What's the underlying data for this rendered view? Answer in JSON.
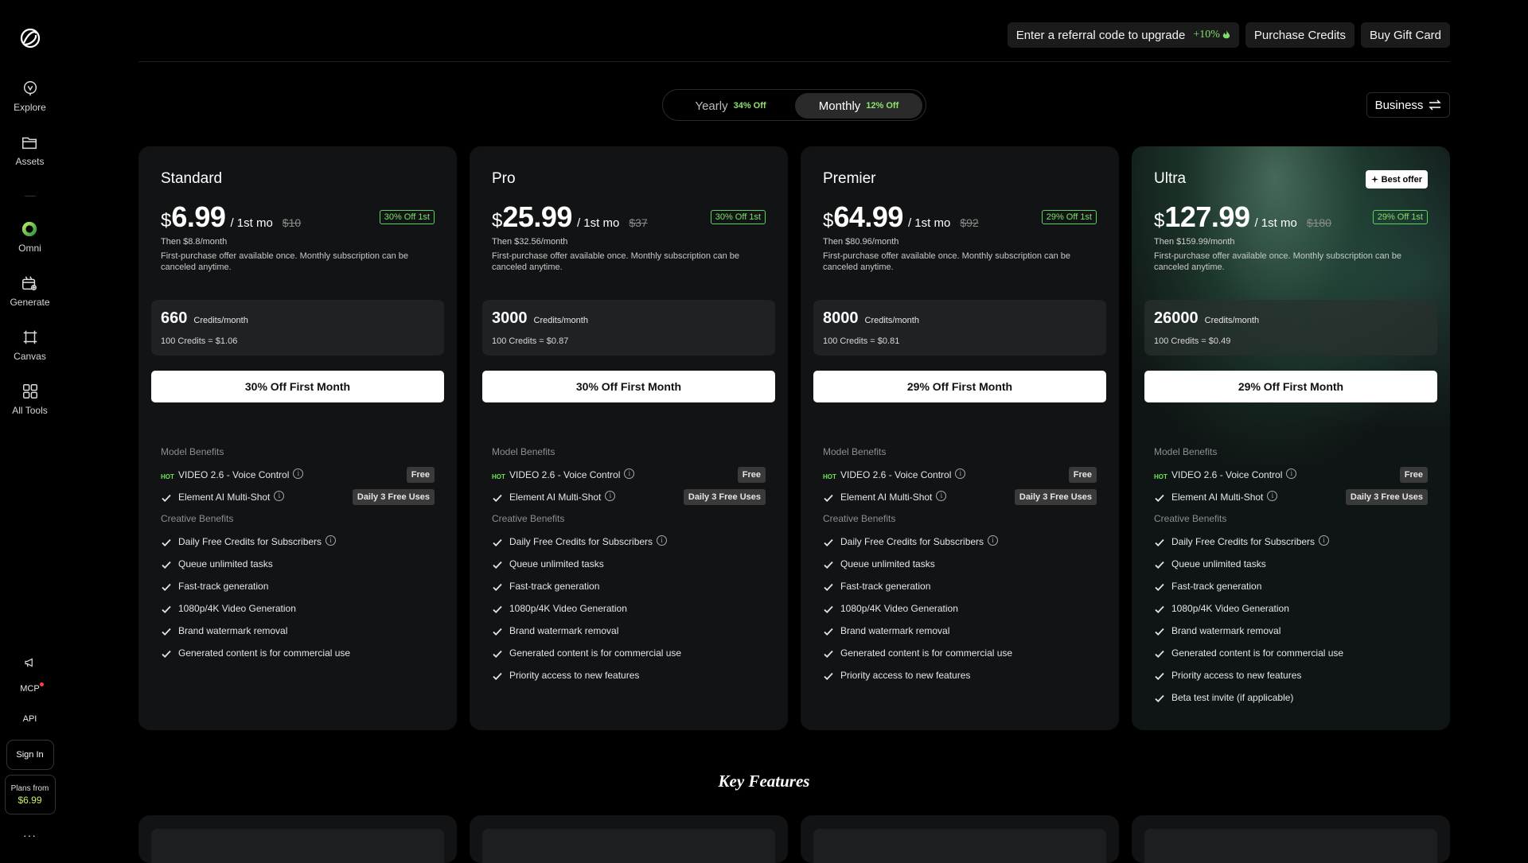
{
  "sidebar": {
    "items": [
      {
        "label": "Explore",
        "icon": "explore-icon"
      },
      {
        "label": "Assets",
        "icon": "folder-icon"
      },
      {
        "label": "Omni",
        "icon": "omni-icon"
      },
      {
        "label": "Generate",
        "icon": "generate-icon"
      },
      {
        "label": "Canvas",
        "icon": "canvas-icon"
      },
      {
        "label": "All Tools",
        "icon": "grid-icon"
      }
    ],
    "mcp_label": "MCP",
    "api_label": "API",
    "sign_in_label": "Sign In",
    "plans_from_label": "Plans from",
    "plans_from_price": "$6.99",
    "more_label": "···"
  },
  "topbar": {
    "referral_label": "Enter a referral code to upgrade",
    "referral_bonus": "+10%",
    "purchase_credits_label": "Purchase Credits",
    "gift_card_label": "Buy Gift Card"
  },
  "billing_toggle": {
    "yearly_label": "Yearly",
    "yearly_off": "34% Off",
    "monthly_label": "Monthly",
    "monthly_off": "12% Off",
    "selected": "Monthly"
  },
  "business_label": "Business",
  "colors": {
    "accent_green": "#7ee06a",
    "card_bg": "#121314",
    "page_bg": "#000000"
  },
  "plans": [
    {
      "name": "Standard",
      "currency": "$",
      "price": "6.99",
      "period": "/ 1st mo",
      "original": "$10",
      "discount_badge": "30% Off 1st",
      "then_prefix": "Then ",
      "then_price": "$8.8",
      "then_suffix": "/month",
      "note": "First-purchase offer available once. Monthly subscription can be canceled anytime.",
      "credits": "660",
      "credits_unit": "Credits/month",
      "rate_prefix": "100 Credits = ",
      "rate": "$1.06",
      "cta": "30% Off First Month",
      "model_benefits_label": "Model Benefits",
      "hot_label": "HOT",
      "video_label": "VIDEO 2.6 - Voice Control",
      "video_tag": "Free",
      "element_label": "Element AI Multi-Shot",
      "element_tag": "Daily 3 Free Uses",
      "creative_benefits_label": "Creative Benefits",
      "daily_credits_label": "Daily Free Credits for Subscribers",
      "features": [
        "Queue unlimited tasks",
        "Fast-track generation",
        "1080p/4K Video Generation",
        "Brand watermark removal",
        "Generated content is for commercial use"
      ]
    },
    {
      "name": "Pro",
      "currency": "$",
      "price": "25.99",
      "period": "/ 1st mo",
      "original": "$37",
      "discount_badge": "30% Off 1st",
      "then_prefix": "Then ",
      "then_price": "$32.56",
      "then_suffix": "/month",
      "note": "First-purchase offer available once. Monthly subscription can be canceled anytime.",
      "credits": "3000",
      "credits_unit": "Credits/month",
      "rate_prefix": "100 Credits = ",
      "rate": "$0.87",
      "cta": "30% Off First Month",
      "model_benefits_label": "Model Benefits",
      "hot_label": "HOT",
      "video_label": "VIDEO 2.6 - Voice Control",
      "video_tag": "Free",
      "element_label": "Element AI Multi-Shot",
      "element_tag": "Daily 3 Free Uses",
      "creative_benefits_label": "Creative Benefits",
      "daily_credits_label": "Daily Free Credits for Subscribers",
      "features": [
        "Queue unlimited tasks",
        "Fast-track generation",
        "1080p/4K Video Generation",
        "Brand watermark removal",
        "Generated content is for commercial use",
        "Priority access to new features"
      ]
    },
    {
      "name": "Premier",
      "currency": "$",
      "price": "64.99",
      "period": "/ 1st mo",
      "original": "$92",
      "discount_badge": "29% Off 1st",
      "then_prefix": "Then ",
      "then_price": "$80.96",
      "then_suffix": "/month",
      "note": "First-purchase offer available once. Monthly subscription can be canceled anytime.",
      "credits": "8000",
      "credits_unit": "Credits/month",
      "rate_prefix": "100 Credits = ",
      "rate": "$0.81",
      "cta": "29% Off First Month",
      "model_benefits_label": "Model Benefits",
      "hot_label": "HOT",
      "video_label": "VIDEO 2.6 - Voice Control",
      "video_tag": "Free",
      "element_label": "Element AI Multi-Shot",
      "element_tag": "Daily 3 Free Uses",
      "creative_benefits_label": "Creative Benefits",
      "daily_credits_label": "Daily Free Credits for Subscribers",
      "features": [
        "Queue unlimited tasks",
        "Fast-track generation",
        "1080p/4K Video Generation",
        "Brand watermark removal",
        "Generated content is for commercial use",
        "Priority access to new features"
      ]
    },
    {
      "name": "Ultra",
      "best_offer": "Best offer",
      "currency": "$",
      "price": "127.99",
      "period": "/ 1st mo",
      "original": "$180",
      "discount_badge": "29% Off 1st",
      "then_prefix": "Then ",
      "then_price": "$159.99",
      "then_suffix": "/month",
      "note": "First-purchase offer available once. Monthly subscription can be canceled anytime.",
      "credits": "26000",
      "credits_unit": "Credits/month",
      "rate_prefix": "100 Credits = ",
      "rate": "$0.49",
      "cta": "29% Off First Month",
      "model_benefits_label": "Model Benefits",
      "hot_label": "HOT",
      "video_label": "VIDEO 2.6 - Voice Control",
      "video_tag": "Free",
      "element_label": "Element AI Multi-Shot",
      "element_tag": "Daily 3 Free Uses",
      "creative_benefits_label": "Creative Benefits",
      "daily_credits_label": "Daily Free Credits for Subscribers",
      "features": [
        "Queue unlimited tasks",
        "Fast-track generation",
        "1080p/4K Video Generation",
        "Brand watermark removal",
        "Generated content is for commercial use",
        "Priority access to new features",
        "Beta test invite (if applicable)"
      ]
    }
  ],
  "key_features_title": "Key Features"
}
